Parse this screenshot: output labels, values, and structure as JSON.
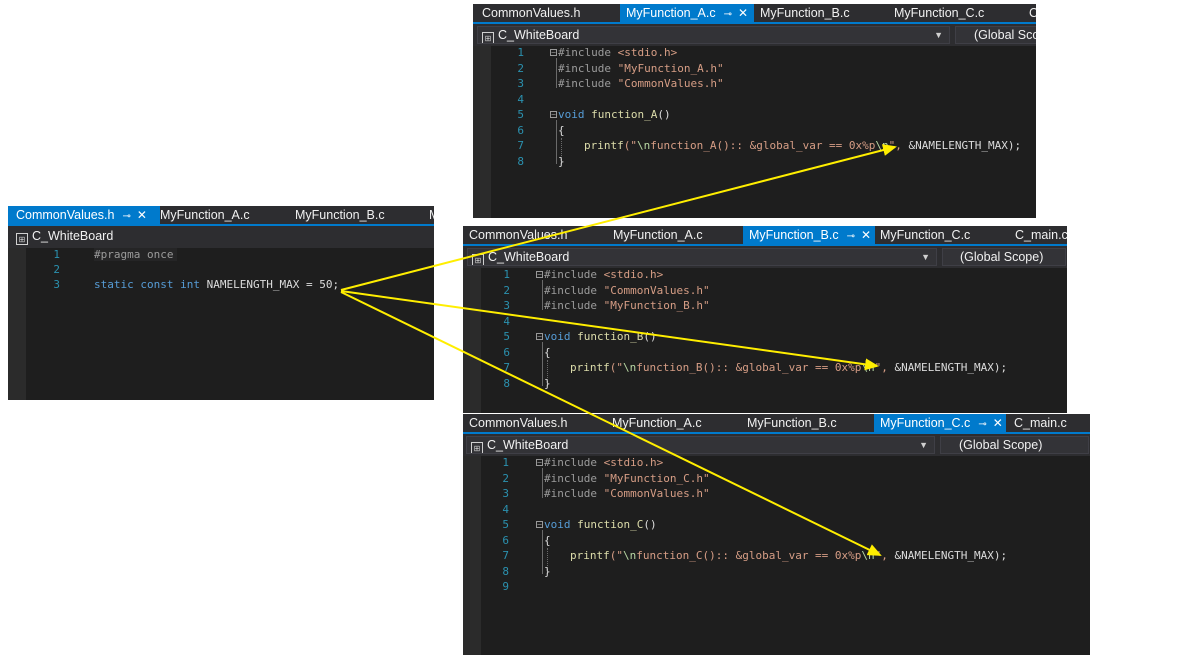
{
  "windows": {
    "header": {
      "tabs": [
        "CommonValues.h",
        "MyFunction_A.c",
        "MyFunction_B.c",
        "M"
      ],
      "active_tab": "CommonValues.h",
      "project": "C_WhiteBoard",
      "lines": [
        "1",
        "2",
        "3"
      ],
      "code": {
        "pragma": "#pragma once",
        "static_kw": "static",
        "const_kw": "const",
        "int_kw": "int",
        "decl": " NAMELENGTH_MAX = 50;"
      }
    },
    "func_a": {
      "tabs": [
        "CommonValues.h",
        "MyFunction_A.c",
        "MyFunction_B.c",
        "MyFunction_C.c",
        "C"
      ],
      "active_tab": "MyFunction_A.c",
      "project": "C_WhiteBoard",
      "scope": "(Global Scop",
      "lines": [
        "1",
        "2",
        "3",
        "4",
        "5",
        "6",
        "7",
        "8"
      ],
      "inc1": "#include",
      "inc1_file": "<stdio.h>",
      "inc2": "#include",
      "inc2_file": "\"MyFunction_A.h\"",
      "inc3": "#include",
      "inc3_file": "\"CommonValues.h\"",
      "void_kw": "void",
      "fn_name": "function_A",
      "fn_paren": "()",
      "open_brace": "{",
      "printf": "printf",
      "printf_open": "(\"",
      "esc1": "\\n",
      "fmt_text": "function_A():: &global_var == 0x%p",
      "esc2": "\\n",
      "fmt_close": "\", ",
      "arg": "&NAMELENGTH_MAX",
      "end": ");",
      "close_brace": "}"
    },
    "func_b": {
      "tabs": [
        "CommonValues.h",
        "MyFunction_A.c",
        "MyFunction_B.c",
        "MyFunction_C.c",
        "C_main.c"
      ],
      "active_tab": "MyFunction_B.c",
      "project": "C_WhiteBoard",
      "scope": "(Global Scope)",
      "lines": [
        "1",
        "2",
        "3",
        "4",
        "5",
        "6",
        "7",
        "8"
      ],
      "inc1": "#include",
      "inc1_file": "<stdio.h>",
      "inc2": "#include",
      "inc2_file": "\"CommonValues.h\"",
      "inc3": "#include",
      "inc3_file": "\"MyFunction_B.h\"",
      "void_kw": "void",
      "fn_name": "function_B",
      "fn_paren": "()",
      "open_brace": "{",
      "printf": "printf",
      "printf_open": "(\"",
      "esc1": "\\n",
      "fmt_text": "function_B():: &global_var == 0x%p",
      "esc2": "\\n",
      "fmt_close": "\", ",
      "arg": "&NAMELENGTH_MAX",
      "end": ");",
      "close_brace": "}"
    },
    "func_c": {
      "tabs": [
        "CommonValues.h",
        "MyFunction_A.c",
        "MyFunction_B.c",
        "MyFunction_C.c",
        "C_main.c"
      ],
      "active_tab": "MyFunction_C.c",
      "project": "C_WhiteBoard",
      "scope": "(Global Scope)",
      "lines": [
        "1",
        "2",
        "3",
        "4",
        "5",
        "6",
        "7",
        "8",
        "9"
      ],
      "inc1": "#include",
      "inc1_file": "<stdio.h>",
      "inc2": "#include",
      "inc2_file": "\"MyFunction_C.h\"",
      "inc3": "#include",
      "inc3_file": "\"CommonValues.h\"",
      "void_kw": "void",
      "fn_name": "function_C",
      "fn_paren": "()",
      "open_brace": "{",
      "printf": "printf",
      "printf_open": "(\"",
      "esc1": "\\n",
      "fmt_text": "function_C():: &global_var == 0x%p",
      "esc2": "\\n",
      "fmt_close": "\", ",
      "arg": "&NAMELENGTH_MAX",
      "end": ");",
      "close_brace": "}"
    }
  },
  "colors": {
    "editor_bg": "#1e1e1e",
    "tab_active": "#007acc",
    "arrow": "#ffee00"
  }
}
